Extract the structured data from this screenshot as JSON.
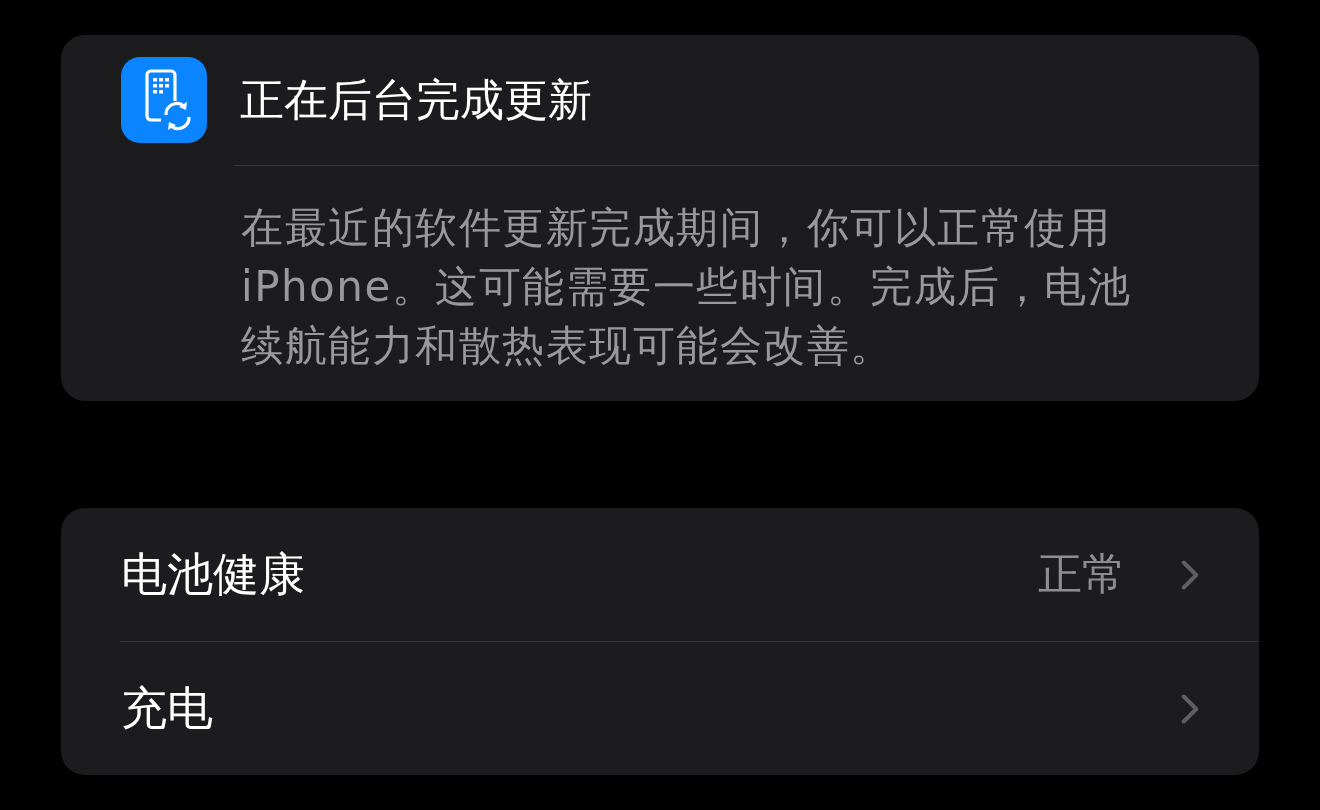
{
  "update_card": {
    "title": "正在后台完成更新",
    "description": "在最近的软件更新完成期间，你可以正常使用 iPhone。这可能需要一些时间。完成后，电池续航能力和散热表现可能会改善。"
  },
  "settings_rows": [
    {
      "label": "电池健康",
      "value": "正常"
    },
    {
      "label": "充电"
    }
  ]
}
